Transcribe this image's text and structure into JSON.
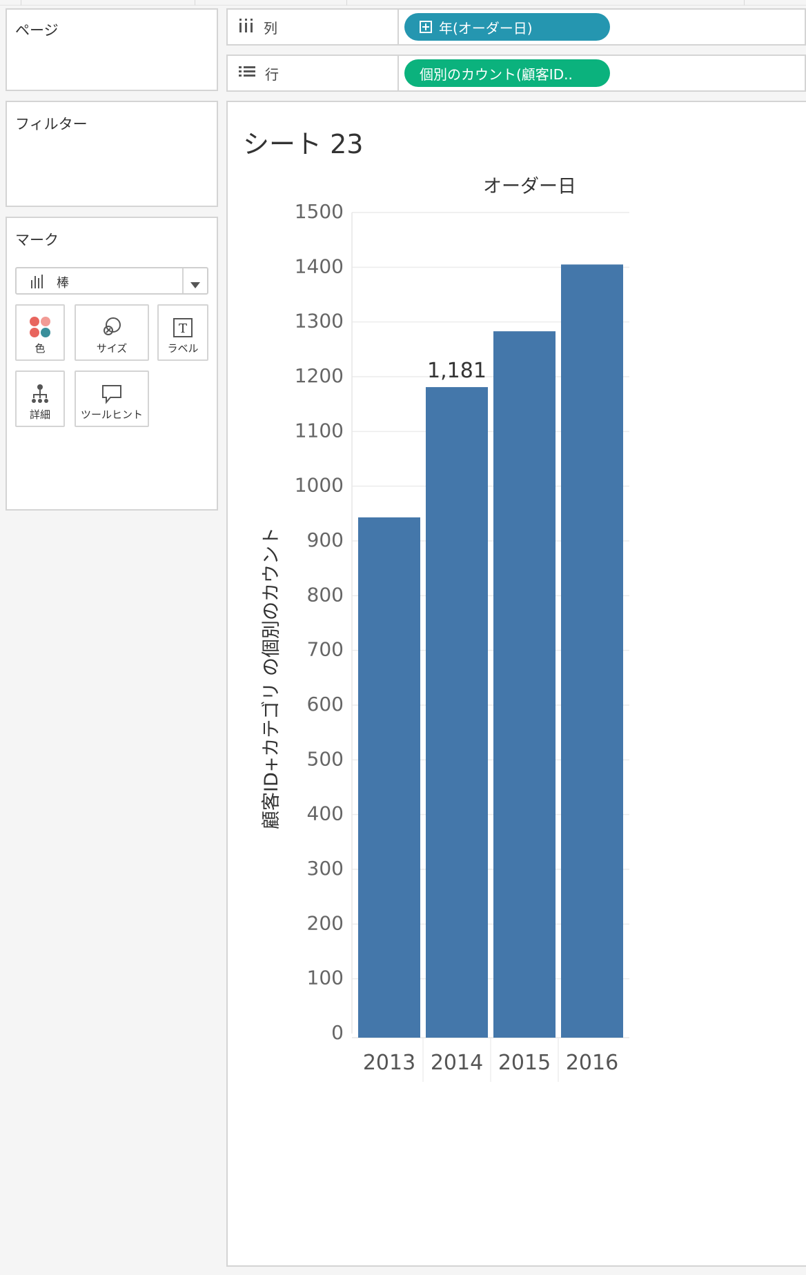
{
  "pages_card": {
    "title": "ページ"
  },
  "filters_card": {
    "title": "フィルター"
  },
  "marks_card": {
    "title": "マーク",
    "mark_type": "棒",
    "buttons": {
      "color": "色",
      "size": "サイズ",
      "label": "ラベル",
      "detail": "詳細",
      "tooltip": "ツールヒント"
    }
  },
  "shelves": {
    "columns": {
      "label": "列",
      "pill": "年(オーダー日)",
      "pill_color": "#2596b0"
    },
    "rows": {
      "label": "行",
      "pill": "個別のカウント(顧客ID..",
      "pill_color": "#0bb27d"
    }
  },
  "sheet": {
    "title": "シート 23"
  },
  "chart_data": {
    "type": "bar",
    "title": "",
    "header": "オーダー日",
    "categories": [
      "2013",
      "2014",
      "2015",
      "2016"
    ],
    "values": [
      943,
      1181,
      1283,
      1405
    ],
    "data_labels": [
      {
        "category": "2014",
        "text": "1,181"
      }
    ],
    "ylabel": "顧客ID+カテゴリ の個別のカウント",
    "xlabel": "",
    "ylim": [
      0,
      1500
    ],
    "yticks": [
      0,
      100,
      200,
      300,
      400,
      500,
      600,
      700,
      800,
      900,
      1000,
      1100,
      1200,
      1300,
      1400,
      1500
    ],
    "bar_color": "#4477aa",
    "grid": true,
    "legend": "none"
  }
}
